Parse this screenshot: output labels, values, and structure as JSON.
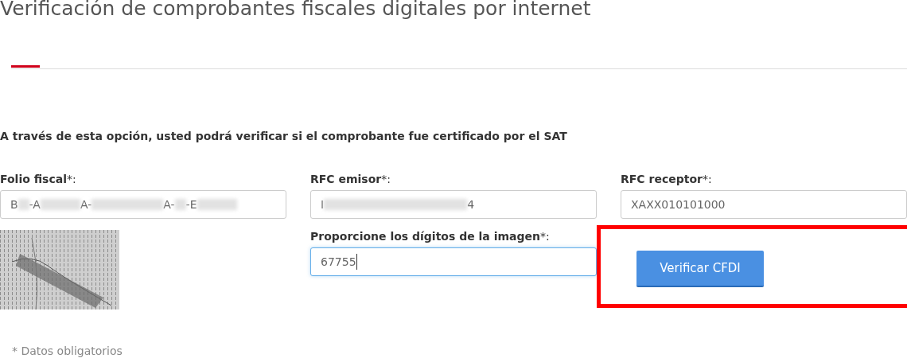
{
  "title": "Verificación de comprobantes fiscales digitales por internet",
  "intro": "A través de esta opción, usted podrá verificar si el comprobante fue certificado por el SAT",
  "fields": [
    {
      "label": "**Folio fiscal***:",
      "segments": [
        {
          "kind": "text",
          "text": "B"
        },
        {
          "kind": "blur"
        },
        {
          "kind": "text",
          "text": "-A"
        },
        {
          "kind": "blur"
        },
        {
          "kind": "text",
          "text": "A-"
        },
        {
          "kind": "blur"
        },
        {
          "kind": "text",
          "text": "A-"
        },
        {
          "kind": "blur"
        },
        {
          "kind": "text",
          "text": "-E"
        },
        {
          "kind": "blur"
        }
      ],
      "focused": false
    },
    {
      "label": "**RFC emisor***:",
      "segments": [
        {
          "kind": "text",
          "text": "I"
        },
        {
          "kind": "blur"
        },
        {
          "kind": "text",
          "text": "4"
        }
      ],
      "focused": false
    },
    {
      "label": "**RFC receptor***:",
      "segments": [
        {
          "kind": "text",
          "text": "XAXX010101000"
        }
      ],
      "focused": false
    }
  ],
  "captcha_field": {
    "label": "**Proporcione los dígitos de la imagen***:",
    "value": "67755",
    "focused": true
  },
  "button": {
    "label": "Verificar CFDI",
    "highlighted": true
  },
  "note": "* Datos obligatorios"
}
